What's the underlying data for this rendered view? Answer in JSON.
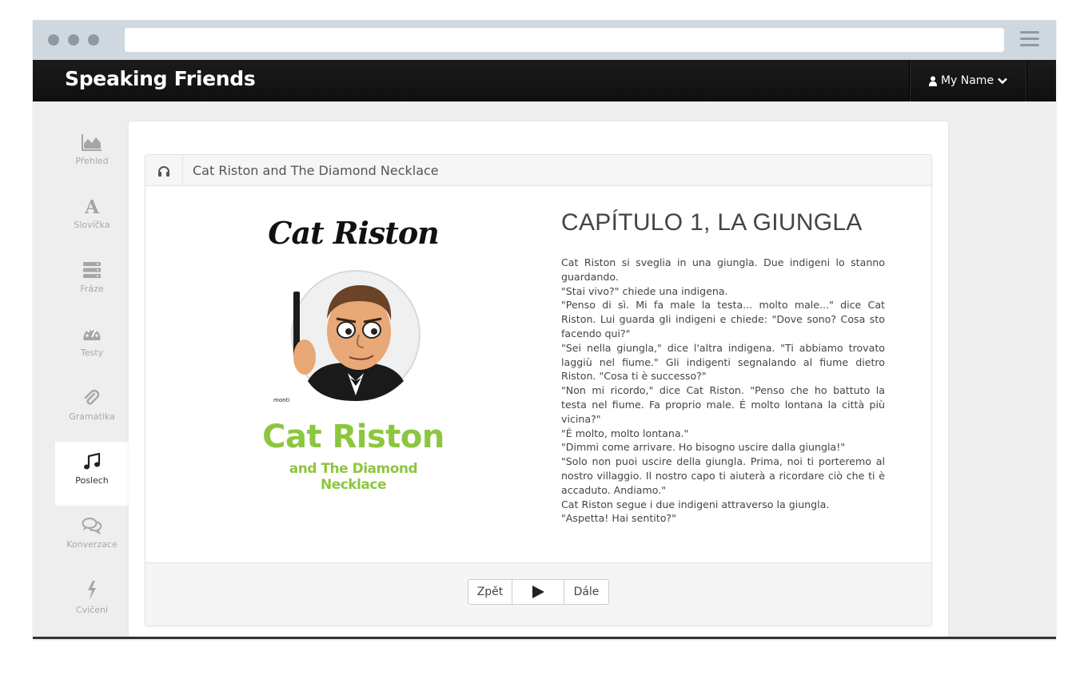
{
  "app": {
    "brand": "Speaking Friends",
    "user_name": "My Name"
  },
  "sidebar": {
    "items": [
      {
        "label": "Přehled",
        "icon": "area-chart-icon",
        "active": false
      },
      {
        "label": "Slovíčka",
        "icon": "letter-a-icon",
        "active": false
      },
      {
        "label": "Fráze",
        "icon": "server-icon",
        "active": false
      },
      {
        "label": "Testy",
        "icon": "dashboard-icon",
        "active": false
      },
      {
        "label": "Gramatika",
        "icon": "paperclip-icon",
        "active": false
      },
      {
        "label": "Poslech",
        "icon": "music-icon",
        "active": true
      },
      {
        "label": "Konverzace",
        "icon": "comments-icon",
        "active": false
      },
      {
        "label": "Cvičení",
        "icon": "bolt-icon",
        "active": false
      }
    ]
  },
  "panel": {
    "icon": "headphones-icon",
    "title": "Cat Riston and The Diamond Necklace"
  },
  "cover": {
    "title": "Cat Riston",
    "green_title": "Cat Riston",
    "subtitle": "and The Diamond Necklace"
  },
  "chapter": {
    "heading": "CAPÍTULO 1, LA GIUNGLA",
    "paragraphs": [
      "Cat Riston si sveglia in una giungla. Due indigeni lo stanno guardando.",
      "\"Stai vivo?\" chiede una indigena.",
      "\"Penso di sì. Mi fa male la testa... molto male...\" dice Cat Riston. Lui guarda gli indigeni e chiede: \"Dove sono? Cosa sto facendo qui?\"",
      "\"Sei nella giungla,\" dice l'altra indigena. \"Ti abbiamo trovato laggiù nel fiume.\" Gli indigenti segnalando al fiume dietro Riston. \"Cosa ti è successo?\"",
      "\"Non mi ricordo,\" dice Cat Riston. \"Penso che ho battuto la testa nel fiume. Fa proprio male. É molto lontana la città più vicina?\"",
      "\"É molto, molto lontana.\"",
      "\"Dimmi come arrivare. Ho bisogno uscire dalla giungla!\"",
      "\"Solo non puoi uscire della giungla. Prima, noi ti porteremo al nostro villaggio. Il nostro capo ti aiuterà a ricordare ciò che ti è accaduto. Andiamo.\"",
      "Cat Riston segue i due indigeni attraverso la giungla.",
      "\"Aspetta! Hai sentito?\""
    ]
  },
  "controls": {
    "prev_label": "Zpět",
    "play_icon": "play-icon",
    "next_label": "Dále"
  },
  "colors": {
    "accent_green": "#8cc63f",
    "nav_dark": "#141414",
    "chrome": "#ced8de"
  }
}
